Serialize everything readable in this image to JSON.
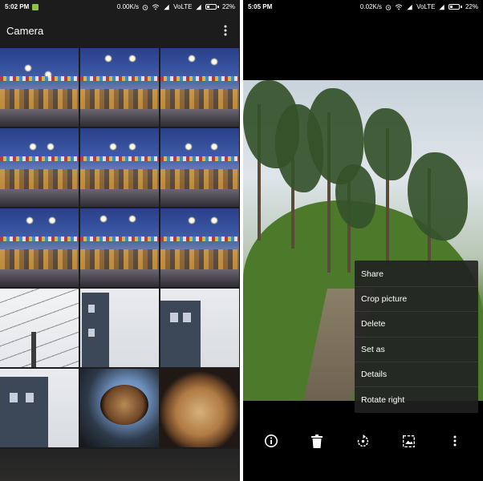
{
  "left_screen": {
    "status": {
      "time": "5:02 PM",
      "speed": "0.00K/s",
      "network": "VoLTE",
      "battery": "22%",
      "battery_level": 0.22
    },
    "appbar": {
      "title": "Camera",
      "menu_icon": "more-vert-icon"
    }
  },
  "right_screen": {
    "status": {
      "time": "5:05 PM",
      "speed": "0.02K/s",
      "network": "VoLTE",
      "battery": "22%",
      "battery_level": 0.22
    },
    "context_menu": {
      "items": [
        "Share",
        "Crop picture",
        "Delete",
        "Set as",
        "Details",
        "Rotate right"
      ]
    },
    "toolbar": [
      {
        "name": "info-icon"
      },
      {
        "name": "delete-icon"
      },
      {
        "name": "rotate-icon"
      },
      {
        "name": "edit-photo-icon"
      },
      {
        "name": "more-vert-icon"
      }
    ]
  },
  "colors": {
    "left_background": "#1c1c1c",
    "right_background": "#000000",
    "menu_background": "#202020",
    "text": "#ffffff"
  }
}
